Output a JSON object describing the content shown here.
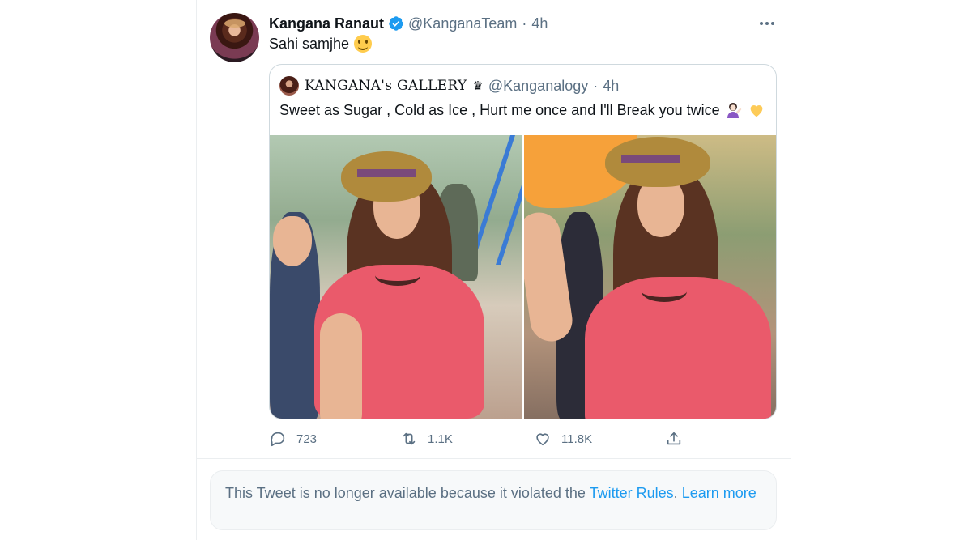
{
  "tweet": {
    "author_name": "Kangana Ranaut",
    "author_handle": "@KanganaTeam",
    "separator": "·",
    "time": "4h",
    "text": "Sahi samjhe",
    "text_emoji": "slightly-smiling-face",
    "more_icon": "more-horizontal-icon",
    "verified_icon": "verified-badge-icon",
    "verified_color": "#1d9bf0"
  },
  "quote": {
    "author_name": "KANGANA's GALLERY",
    "crown": "♛",
    "author_handle": "@Kanganalogy",
    "separator": "·",
    "time": "4h",
    "text": "Sweet as Sugar , Cold as Ice , Hurt me once and I'll Break you twice",
    "text_emojis": [
      "woman-tipping-hand",
      "yellow-heart"
    ]
  },
  "actions": {
    "reply": {
      "icon": "reply-icon",
      "count": "723"
    },
    "retweet": {
      "icon": "retweet-icon",
      "count": "1.1K"
    },
    "like": {
      "icon": "heart-icon",
      "count": "11.8K"
    },
    "share": {
      "icon": "share-icon"
    }
  },
  "notice": {
    "text": "This Tweet is no longer available because it violated the ",
    "rules_link": "Twitter Rules",
    "period": ".",
    "learn_more": "Learn more"
  },
  "colors": {
    "link": "#1d9bf0",
    "secondary_text": "#5b7083",
    "border": "#cfd9de"
  }
}
